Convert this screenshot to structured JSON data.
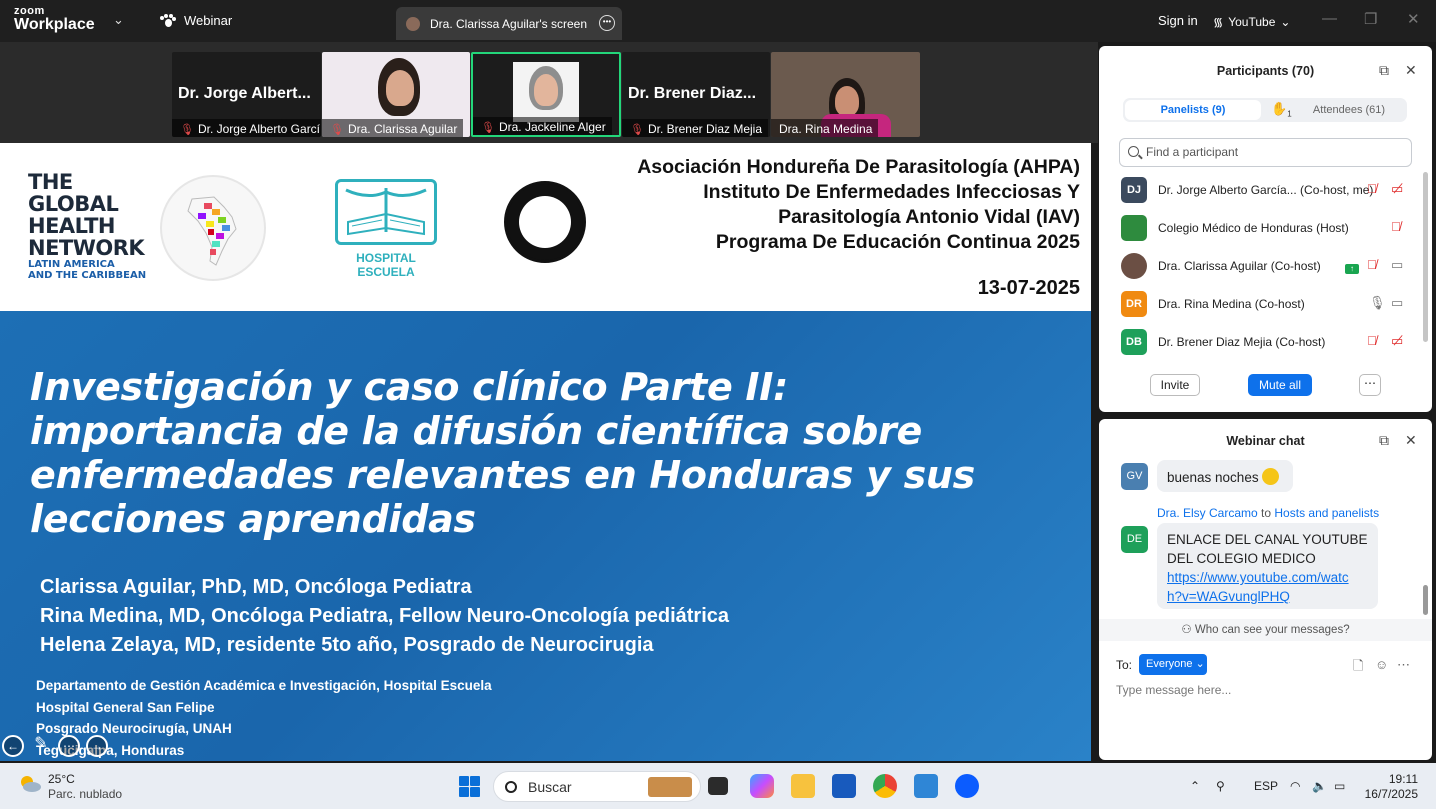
{
  "topbar": {
    "brand_top": "zoom",
    "brand_bottom": "Workplace",
    "webinar_tab": "Webinar",
    "screen_tab": "Dra. Clarissa Aguilar's screen",
    "sign_in": "Sign in",
    "youtube": "YouTube"
  },
  "video_tiles": [
    {
      "display_name": "Dr. Jorge Albert...",
      "label": "Dr. Jorge Alberto Garcí..."
    },
    {
      "display_name": "",
      "label": "Dra. Clarissa Aguilar"
    },
    {
      "display_name": "",
      "label": "Dra. Jackeline Alger"
    },
    {
      "display_name": "Dr. Brener Diaz...",
      "label": "Dr. Brener Diaz Mejia"
    },
    {
      "display_name": "",
      "label": "Dra. Rina Medina"
    }
  ],
  "slide": {
    "network_logo": [
      "THE",
      "GLOBAL",
      "HEALTH",
      "NETWORK"
    ],
    "network_sub": [
      "LATIN AMERICA",
      "AND THE CARIBBEAN"
    ],
    "hospital_logo_text": "HOSPITAL ESCUELA",
    "org_lines": [
      "Asociación Hondureña De Parasitología (AHPA)",
      "Instituto De Enfermedades Infecciosas Y",
      "Parasitología Antonio Vidal (IAV)",
      "Programa De Educación Continua 2025"
    ],
    "date": "13-07-2025",
    "title_lines": [
      "Investigación y caso clínico Parte II:",
      "importancia de la difusión científica sobre",
      "enfermedades relevantes en Honduras y sus",
      "lecciones aprendidas"
    ],
    "authors": [
      "Clarissa Aguilar, PhD, MD, Oncóloga Pediatra",
      "Rina Medina, MD, Oncóloga Pediatra, Fellow Neuro-Oncología pediátrica",
      "Helena Zelaya, MD, residente 5to año, Posgrado de Neurocirugia"
    ],
    "departments": [
      "Departamento de Gestión Académica e Investigación, Hospital Escuela",
      "Hospital General San Felipe",
      "Posgrado Neurocirugía, UNAH",
      "Tegucigalpa, Honduras"
    ]
  },
  "participants": {
    "title": "Participants (70)",
    "tab_panelists": "Panelists (9)",
    "raised_hands": "1",
    "tab_attendees": "Attendees (61)",
    "search_placeholder": "Find a participant",
    "rows": [
      {
        "initials": "DJ",
        "name": "Dr. Jorge Alberto García... (Co-host, me)",
        "color": "#3b4a5e"
      },
      {
        "initials": "",
        "name": "Colegio Médico de Honduras (Host)",
        "color": "#2e8b3e"
      },
      {
        "initials": "",
        "name": "Dra. Clarissa Aguilar (Co-host)",
        "color": "#6b4f44"
      },
      {
        "initials": "DR",
        "name": "Dra. Rina Medina (Co-host)",
        "color": "#f08a11"
      },
      {
        "initials": "DB",
        "name": "Dr. Brener Diaz Mejia (Co-host)",
        "color": "#1ea05a"
      }
    ],
    "invite": "Invite",
    "mute_all": "Mute all"
  },
  "chat": {
    "title": "Webinar chat",
    "msg1_initials": "GV",
    "msg1_text": "buenas noches",
    "msg2_sender": "Dra. Elsy Carcamo",
    "msg2_to_word": "to",
    "msg2_to": "Hosts and panelists",
    "msg2_initials": "DE",
    "msg2_lines": [
      "ENLACE DEL CANAL YOUTUBE",
      "DEL COLEGIO MEDICO"
    ],
    "msg2_link": [
      "https://www.youtube.com/watc",
      "h?v=WAGvunglPHQ"
    ],
    "who_can_see": "Who can see your messages?",
    "to_label": "To:",
    "recipient": "Everyone",
    "input_placeholder": "Type message here..."
  },
  "taskbar": {
    "temperature": "25°C",
    "weather": "Parc. nublado",
    "search": "Buscar",
    "language": "ESP",
    "time": "19:11",
    "date": "16/7/2025"
  }
}
